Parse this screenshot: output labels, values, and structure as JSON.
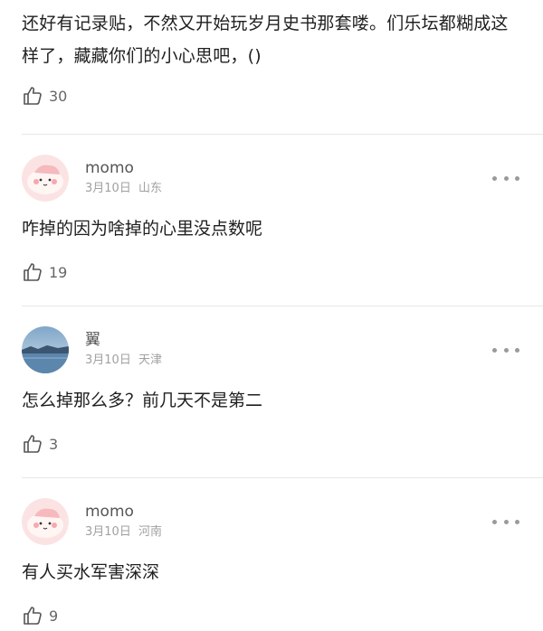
{
  "top_comment": {
    "text": "还好有记录贴，不然又开始玩岁月史书那套喽。们乐坛都糊成这样了，藏藏你们的小心思吧，()",
    "likes": "30"
  },
  "comments": [
    {
      "user": "momo",
      "date": "3月10日",
      "location": "山东",
      "text": "咋掉的因为啥掉的心里没点数呢",
      "likes": "19",
      "avatar": "pink-creature-avatar"
    },
    {
      "user": "翼",
      "date": "3月10日",
      "location": "天津",
      "text": "怎么掉那么多？前几天不是第二",
      "likes": "3",
      "avatar": "landscape-avatar"
    },
    {
      "user": "momo",
      "date": "3月10日",
      "location": "河南",
      "text": "有人买水军害深深",
      "likes": "9",
      "avatar": "pink-creature-avatar"
    }
  ],
  "icons": {
    "like": "thumbs-up-outline-icon",
    "more": "more-dots-icon"
  },
  "colors": {
    "text": "#1f1f1f",
    "muted": "#a0a0a0",
    "divider": "#e7e7e7"
  }
}
